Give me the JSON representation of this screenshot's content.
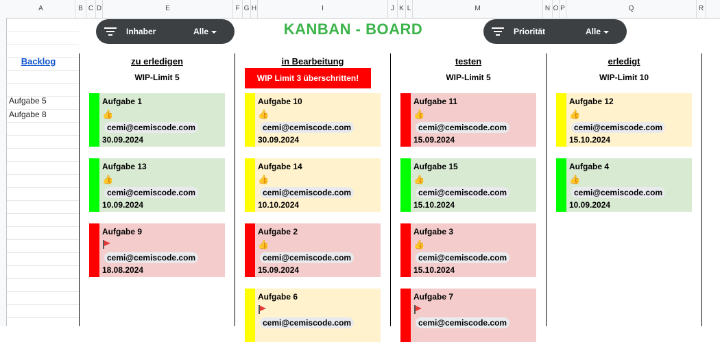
{
  "sheet": {
    "columns": [
      "A",
      "B",
      "C",
      "D",
      "E",
      "F",
      "G",
      "H",
      "I",
      "J",
      "K",
      "L",
      "M",
      "N",
      "O",
      "P",
      "Q",
      "R"
    ]
  },
  "filters": {
    "owner": {
      "label": "Inhaber",
      "value": "Alle"
    },
    "priority": {
      "label": "Priorität",
      "value": "Alle"
    }
  },
  "title": "KANBAN - BOARD",
  "backlog": {
    "link": "Backlog",
    "items": [
      "Aufgabe 5",
      "Aufgabe 8"
    ]
  },
  "colors": {
    "green": "#00ff00",
    "yellow": "#ffff00",
    "red": "#ff0000",
    "card_green": "#d9ead3",
    "card_yellow": "#fff2cc",
    "card_red": "#f4cccc"
  },
  "board": [
    {
      "name": "zu erledigen",
      "wip": "WIP-Limit 5",
      "wip_warning": false,
      "cards": [
        {
          "title": "Aufgabe 1",
          "icon": "thumbs-up-icon",
          "owner": "cemi@cemiscode.com",
          "date": "30.09.2024",
          "status": "green"
        },
        {
          "title": "Aufgabe 13",
          "icon": "thumbs-up-icon",
          "owner": "cemi@cemiscode.com",
          "date": "10.09.2024",
          "status": "green"
        },
        {
          "title": "Aufgabe 9",
          "icon": "flag-icon",
          "owner": "cemi@cemiscode.com",
          "date": "18.08.2024",
          "status": "red"
        }
      ]
    },
    {
      "name": "in Bearbeitung",
      "wip": "WIP Limit 3 überschritten!",
      "wip_warning": true,
      "cards": [
        {
          "title": "Aufgabe 10",
          "icon": "thumbs-up-icon",
          "owner": "cemi@cemiscode.com",
          "date": "30.09.2024",
          "status": "yellow"
        },
        {
          "title": "Aufgabe 14",
          "icon": "thumbs-up-icon",
          "owner": "cemi@cemiscode.com",
          "date": "10.10.2024",
          "status": "yellow"
        },
        {
          "title": "Aufgabe 2",
          "icon": "thumbs-up-icon",
          "owner": "cemi@cemiscode.com",
          "date": "15.09.2024",
          "status": "red"
        },
        {
          "title": "Aufgabe 6",
          "icon": "flag-icon",
          "owner": "cemi@cemiscode.com",
          "date": "",
          "status": "yellow"
        }
      ]
    },
    {
      "name": "testen",
      "wip": "WIP-Limit 5",
      "wip_warning": false,
      "cards": [
        {
          "title": "Aufgabe 11",
          "icon": "thumbs-up-icon",
          "owner": "cemi@cemiscode.com",
          "date": "15.09.2024",
          "status": "red"
        },
        {
          "title": "Aufgabe 15",
          "icon": "thumbs-up-icon",
          "owner": "cemi@cemiscode.com",
          "date": "15.10.2024",
          "status": "green"
        },
        {
          "title": "Aufgabe 3",
          "icon": "thumbs-up-icon",
          "owner": "cemi@cemiscode.com",
          "date": "15.10.2024",
          "status": "red"
        },
        {
          "title": "Aufgabe 7",
          "icon": "flag-icon",
          "owner": "cemi@cemiscode.com",
          "date": "",
          "status": "red"
        }
      ]
    },
    {
      "name": "erledigt",
      "wip": "WIP-Limit 10",
      "wip_warning": false,
      "cards": [
        {
          "title": "Aufgabe 12",
          "icon": "thumbs-up-icon",
          "owner": "cemi@cemiscode.com",
          "date": "15.10.2024",
          "status": "yellow"
        },
        {
          "title": "Aufgabe 4",
          "icon": "thumbs-up-icon",
          "owner": "cemi@cemiscode.com",
          "date": "10.09.2024",
          "status": "green"
        }
      ]
    }
  ]
}
